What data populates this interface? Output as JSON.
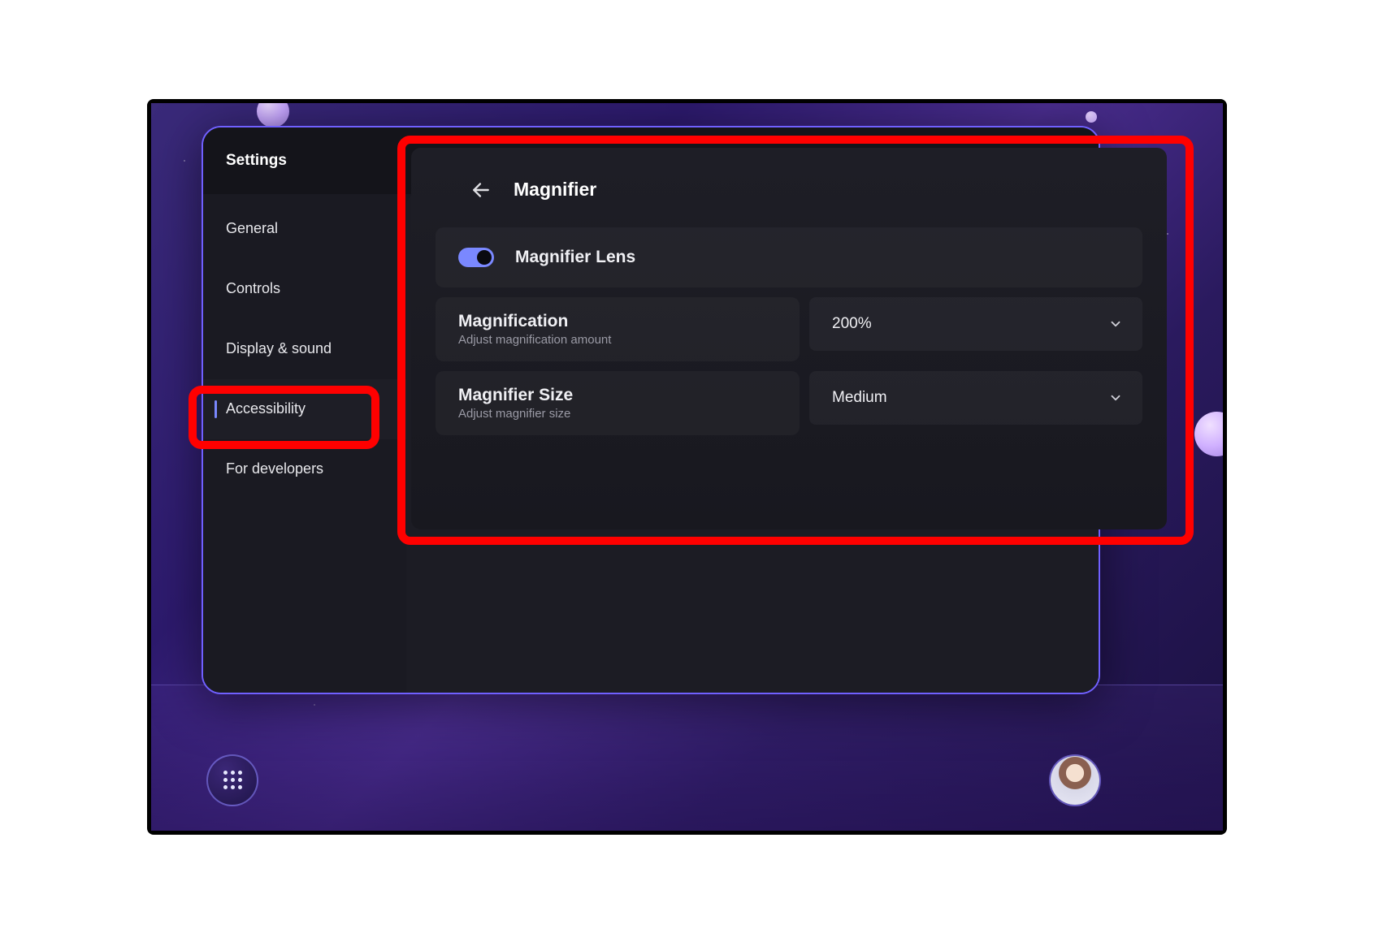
{
  "window": {
    "title": "Settings"
  },
  "sidebar": {
    "items": [
      {
        "label": "General"
      },
      {
        "label": "Controls"
      },
      {
        "label": "Display & sound"
      },
      {
        "label": "Accessibility"
      },
      {
        "label": "For developers"
      }
    ],
    "activeIndex": 3
  },
  "panel": {
    "title": "Magnifier",
    "lens": {
      "label": "Magnifier Lens",
      "enabled": true
    },
    "magnification": {
      "label": "Magnification",
      "sub": "Adjust magnification amount",
      "value": "200%"
    },
    "size": {
      "label": "Magnifier Size",
      "sub": "Adjust magnifier size",
      "value": "Medium"
    }
  },
  "colors": {
    "accent": "#7a88ff",
    "highlight": "#ff0000"
  }
}
